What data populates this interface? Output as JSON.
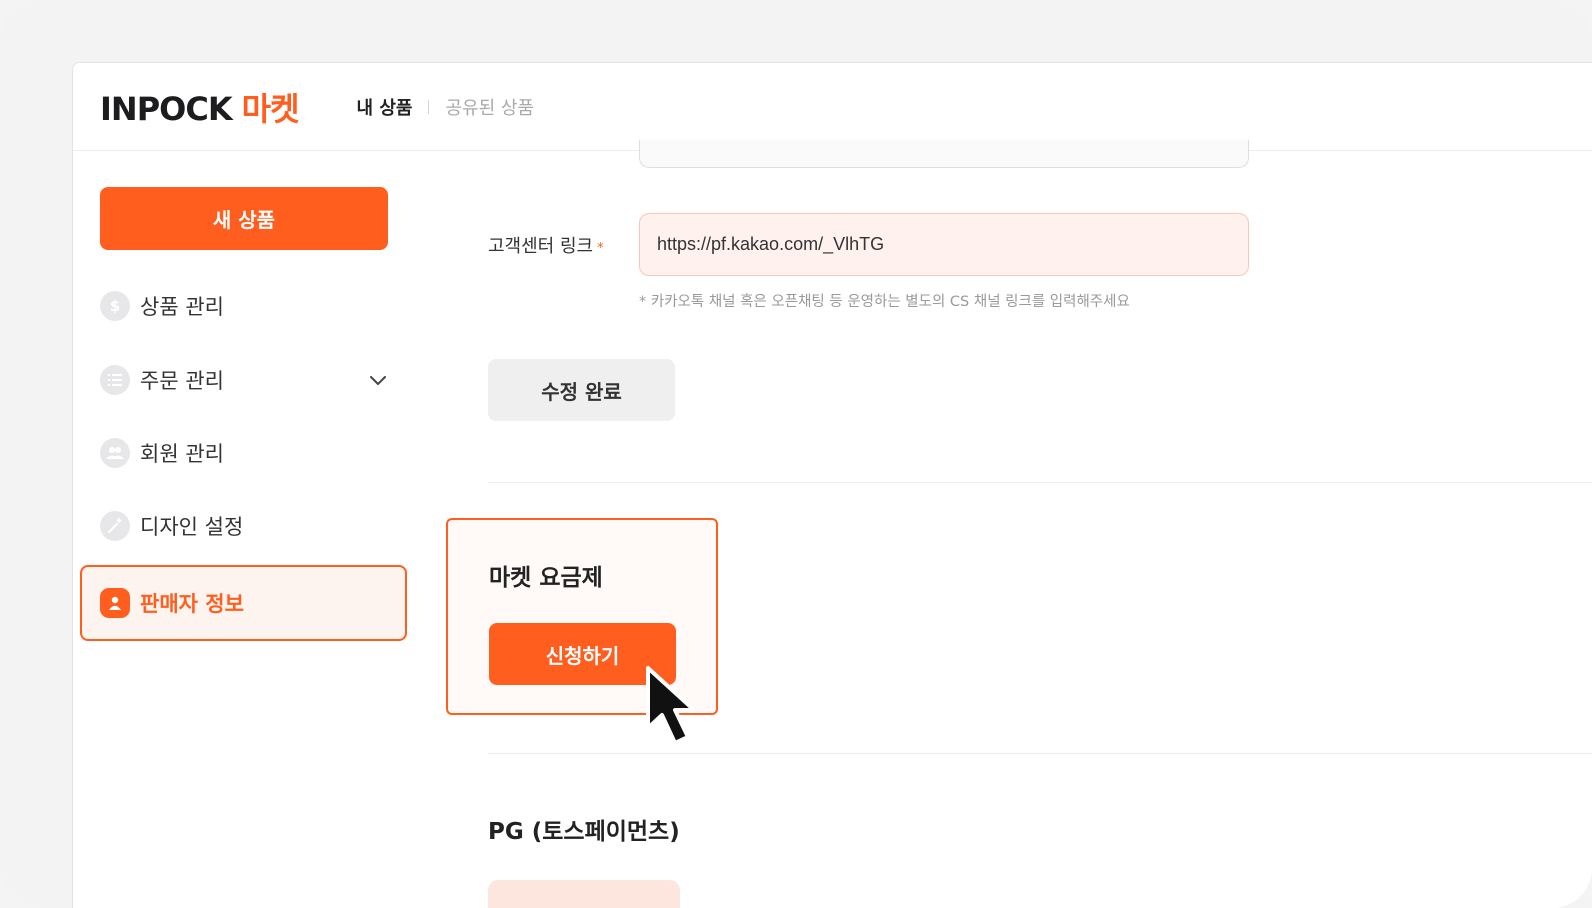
{
  "app": {
    "logo_en": "INPOCK",
    "logo_ko": "마켓",
    "accent_color": "#ff5e1e"
  },
  "topnav": {
    "my_products": "내 상품",
    "shared_products": "공유된 상품"
  },
  "sidebar": {
    "new_product_button": "새 상품",
    "items": [
      {
        "label": "상품 관리",
        "icon": "dollar-icon"
      },
      {
        "label": "주문 관리",
        "icon": "list-icon",
        "expandable": true
      },
      {
        "label": "회원 관리",
        "icon": "users-icon"
      },
      {
        "label": "디자인 설정",
        "icon": "magic-wand-icon"
      },
      {
        "label": "판매자 정보",
        "icon": "person-icon",
        "active": true
      }
    ]
  },
  "form": {
    "cs_link_label": "고객센터 링크",
    "required_mark": "*",
    "cs_link_value": "https://pf.kakao.com/_VlhTG",
    "cs_link_hint": "* 카카오톡 채널 혹은 오픈채팅 등 운영하는 별도의 CS 채널 링크를 입력해주세요",
    "save_button": "수정 완료"
  },
  "plan": {
    "title": "마켓 요금제",
    "apply_button": "신청하기"
  },
  "pg": {
    "title": "PG (토스페이먼츠)"
  }
}
